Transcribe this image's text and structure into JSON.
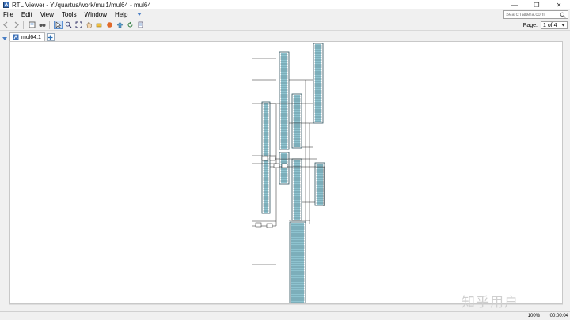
{
  "window": {
    "title": "RTL Viewer - Y:/quartus/work/mul1/mul64 - mul64",
    "controls": [
      "—",
      "❐",
      "✕"
    ]
  },
  "menu": [
    "File",
    "Edit",
    "View",
    "Tools",
    "Window",
    "Help"
  ],
  "search": {
    "placeholder": "Search altera.com"
  },
  "toolbar": {
    "icons": [
      "back-icon",
      "forward-icon",
      "fit-to-window-icon",
      "find-icon",
      "selection-tool-icon",
      "zoom-tool-icon",
      "fit-icon",
      "hand-icon",
      "highlight-icon",
      "netlist-nav-icon",
      "up-hierarchy-icon",
      "refresh-icon",
      "page-icon"
    ]
  },
  "page": {
    "label": "Page:",
    "value": "1 of 4"
  },
  "tabs": [
    {
      "label": "mul64:1"
    }
  ],
  "status": {
    "zoom": "100%",
    "elapsed": "00:00:04"
  },
  "watermark": "知乎用户",
  "colors": {
    "accent": "#5b8fd1",
    "block_fill": "#8ec3cf",
    "block_border": "#2a4f5a"
  }
}
